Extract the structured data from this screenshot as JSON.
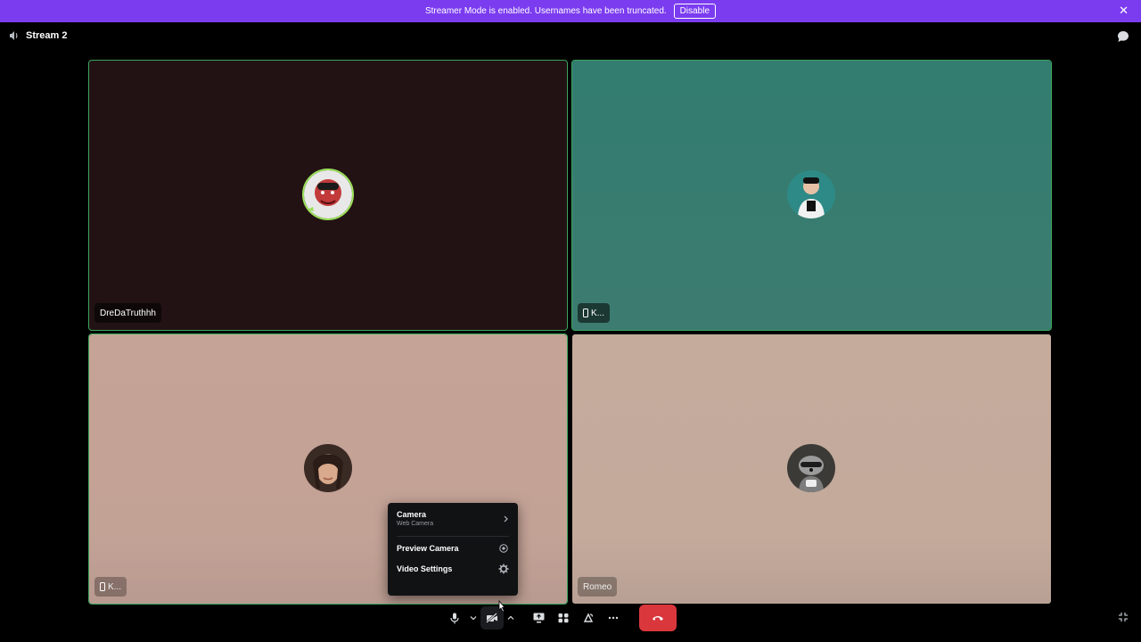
{
  "banner": {
    "message": "Streamer Mode is enabled. Usernames have been truncated.",
    "disable_label": "Disable",
    "close_glyph": "✕",
    "color": "#7b3cf0"
  },
  "header": {
    "channel_name": "Stream 2",
    "channel_icon": "speaker-icon",
    "chat_icon": "chat-bubble-icon"
  },
  "tiles": [
    {
      "name": "DreDaTruthhh",
      "speaking": true,
      "mobile": false
    },
    {
      "name": "K...",
      "speaking": true,
      "mobile": true
    },
    {
      "name": "K...",
      "speaking": true,
      "mobile": true
    },
    {
      "name": "Romeo",
      "speaking": false,
      "mobile": false
    }
  ],
  "camera_menu": {
    "camera_label": "Camera",
    "camera_sub": "Web Camera",
    "preview_label": "Preview Camera",
    "settings_label": "Video Settings"
  },
  "controls": {
    "items": [
      "microphone-icon",
      "chevron-down-icon",
      "camera-off-icon",
      "chevron-up-icon",
      "screen-share-icon",
      "activities-icon",
      "soundboard-icon",
      "more-icon",
      "hang-up-icon"
    ]
  },
  "colors": {
    "speaking_ring": "#3ba55d",
    "end_call": "#da373c",
    "tile1_bg": "#221214",
    "tile2_bg": "#327c70",
    "tile3_bg": "#c5a396",
    "tile4_bg": "#c4ab9c"
  }
}
